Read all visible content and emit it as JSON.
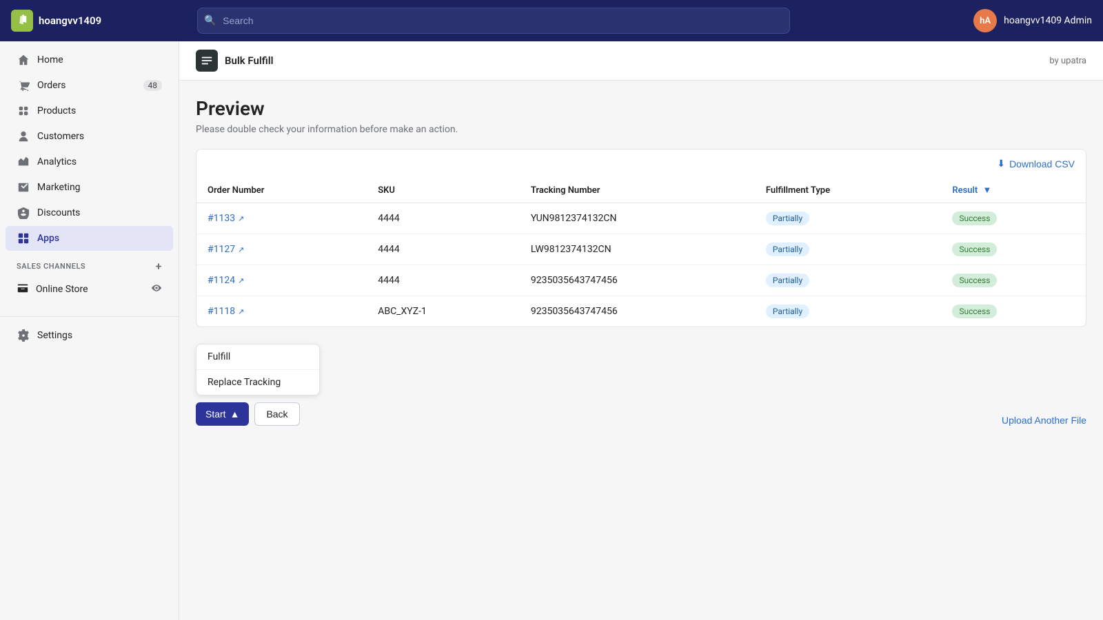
{
  "topnav": {
    "store_name": "hoangvv1409",
    "search_placeholder": "Search",
    "admin_label": "hoangvv1409 Admin",
    "avatar_initials": "hA"
  },
  "sidebar": {
    "items": [
      {
        "id": "home",
        "label": "Home",
        "icon": "home",
        "badge": null
      },
      {
        "id": "orders",
        "label": "Orders",
        "icon": "orders",
        "badge": "48"
      },
      {
        "id": "products",
        "label": "Products",
        "icon": "products",
        "badge": null
      },
      {
        "id": "customers",
        "label": "Customers",
        "icon": "customers",
        "badge": null
      },
      {
        "id": "analytics",
        "label": "Analytics",
        "icon": "analytics",
        "badge": null
      },
      {
        "id": "marketing",
        "label": "Marketing",
        "icon": "marketing",
        "badge": null
      },
      {
        "id": "discounts",
        "label": "Discounts",
        "icon": "discounts",
        "badge": null
      },
      {
        "id": "apps",
        "label": "Apps",
        "icon": "apps",
        "badge": null
      }
    ],
    "sales_channels_label": "SALES CHANNELS",
    "online_store_label": "Online Store",
    "settings_label": "Settings"
  },
  "app_header": {
    "title": "Bulk Fulfill",
    "by_label": "by upatra"
  },
  "preview": {
    "title": "Preview",
    "subtitle": "Please double check your information before make an action."
  },
  "table": {
    "download_csv_label": "Download CSV",
    "columns": {
      "order_number": "Order Number",
      "sku": "SKU",
      "tracking_number": "Tracking Number",
      "fulfillment_type": "Fulfillment Type",
      "result": "Result"
    },
    "rows": [
      {
        "order": "#1133",
        "sku": "4444",
        "tracking": "YUN9812374132CN",
        "fulfillment": "Partially",
        "result": "Success"
      },
      {
        "order": "#1127",
        "sku": "4444",
        "tracking": "LW9812374132CN",
        "fulfillment": "Partially",
        "result": "Success"
      },
      {
        "order": "#1124",
        "sku": "4444",
        "tracking": "9235035643747456",
        "fulfillment": "Partially",
        "result": "Success"
      },
      {
        "order": "#1118",
        "sku": "ABC_XYZ-1",
        "tracking": "9235035643747456",
        "fulfillment": "Partially",
        "result": "Success"
      }
    ]
  },
  "dropdown": {
    "item1": "Fulfill",
    "item2": "Replace Tracking"
  },
  "buttons": {
    "start": "Start",
    "back": "Back"
  },
  "upload_link": "Upload Another File"
}
